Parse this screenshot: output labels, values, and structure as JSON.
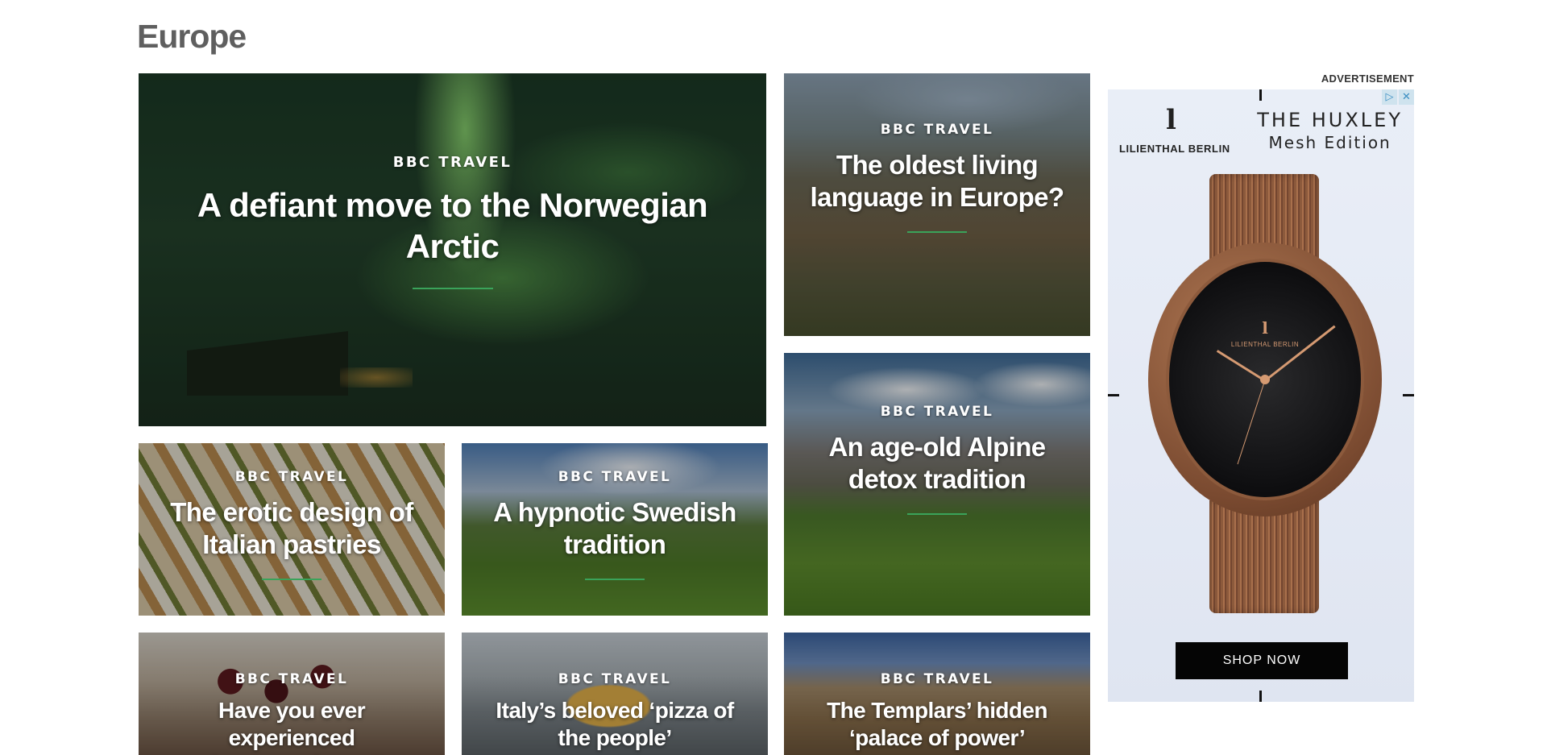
{
  "section": {
    "title": "Europe"
  },
  "cards": [
    {
      "kicker": "BBC TRAVEL",
      "headline": "A defiant move to the Norwegian Arctic"
    },
    {
      "kicker": "BBC TRAVEL",
      "headline": "The oldest living language in Europe?"
    },
    {
      "kicker": "BBC TRAVEL",
      "headline": "An age-old Alpine detox tradition"
    },
    {
      "kicker": "BBC TRAVEL",
      "headline": "The erotic design of Italian pastries"
    },
    {
      "kicker": "BBC TRAVEL",
      "headline": "A hypnotic Swedish tradition"
    },
    {
      "kicker": "BBC TRAVEL",
      "headline": "Have you ever experienced shemomechama?"
    },
    {
      "kicker": "BBC TRAVEL",
      "headline": "Italy’s beloved ‘pizza of the people’"
    },
    {
      "kicker": "BBC TRAVEL",
      "headline": "The Templars’ hidden ‘palace of power’"
    }
  ],
  "advertisement": {
    "label": "ADVERTISEMENT",
    "brand_logo": "l",
    "brand_name": "LILIENTHAL BERLIN",
    "product_line1": "THE HUXLEY",
    "product_line2": "Mesh Edition",
    "dial_logo": "l",
    "dial_text": "LILIENTHAL BERLIN",
    "cta": "SHOP NOW",
    "adchoices_icon": "ad-choices-icon",
    "close_icon": "close-icon"
  },
  "colors": {
    "accent_rule": "#3aa35a",
    "title_gray": "#5f5f5f"
  }
}
